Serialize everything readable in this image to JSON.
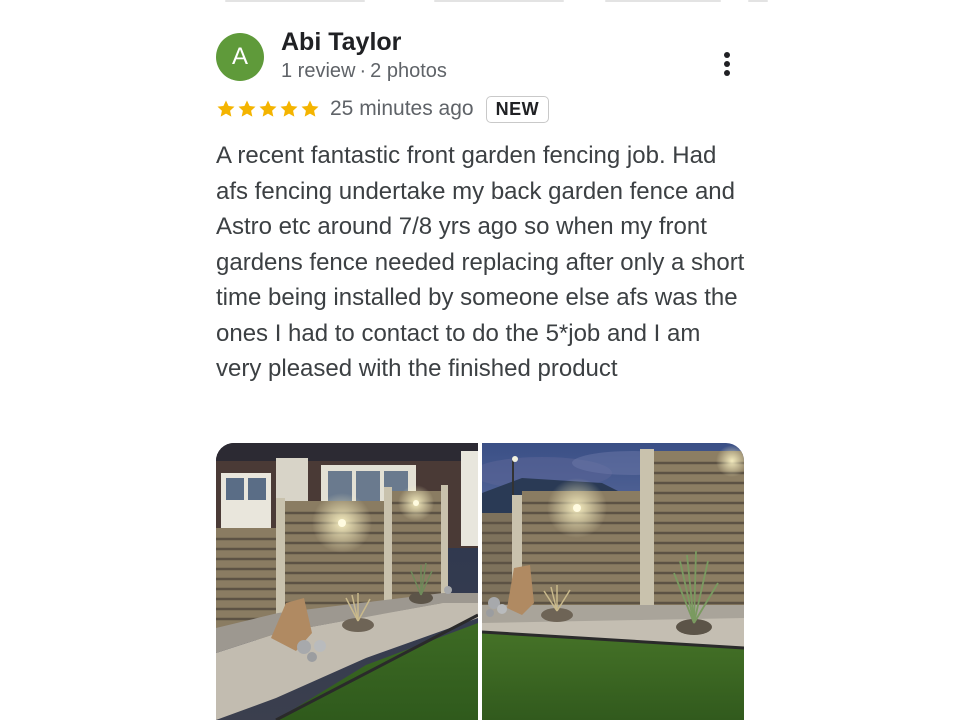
{
  "reviewer": {
    "initial": "A",
    "name": "Abi Taylor",
    "review_count": "1 review",
    "separator": "·",
    "photo_count": "2 photos"
  },
  "review": {
    "rating": 5,
    "rating_max": 5,
    "time_ago": "25 minutes ago",
    "badge": "NEW",
    "text": "A recent fantastic front garden fencing job. Had afs fencing undertake my back garden fence and Astro etc around 7/8 yrs ago so when my front gardens fence needed replacing after only a short time being installed by someone else afs was the ones I had to contact to do the 5*job and I am very pleased with the finished product"
  },
  "colors": {
    "avatar": "#5f9a3a",
    "star": "#f4b400",
    "text": "#3c4043",
    "meta": "#5f6368"
  },
  "icons": {
    "more": "more-vert-icon",
    "star": "star-icon"
  },
  "photos": [
    "garden-fence-photo-1",
    "garden-fence-photo-2"
  ]
}
